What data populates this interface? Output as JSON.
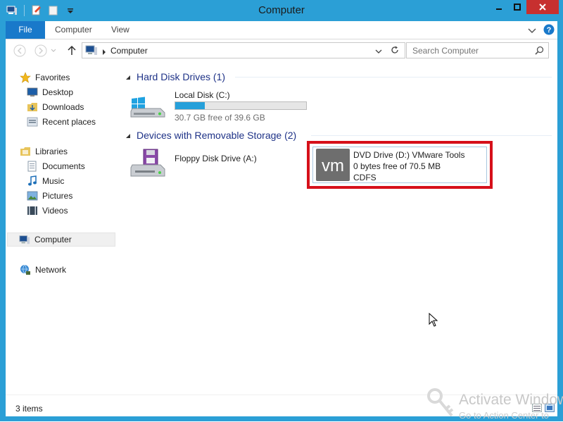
{
  "window": {
    "title": "Computer"
  },
  "ribbon": {
    "file": "File",
    "computer": "Computer",
    "view": "View"
  },
  "address": {
    "crumb": "Computer"
  },
  "search": {
    "placeholder": "Search Computer"
  },
  "nav": {
    "favorites": "Favorites",
    "desktop": "Desktop",
    "downloads": "Downloads",
    "recent": "Recent places",
    "libraries": "Libraries",
    "documents": "Documents",
    "music": "Music",
    "pictures": "Pictures",
    "videos": "Videos",
    "computer": "Computer",
    "network": "Network"
  },
  "groups": {
    "hdd": "Hard Disk Drives (1)",
    "removable": "Devices with Removable Storage (2)"
  },
  "drives": {
    "local": {
      "name": "Local Disk (C:)",
      "free": "30.7 GB free of 39.6 GB",
      "used_fraction": 0.225
    },
    "floppy": {
      "name": "Floppy Disk Drive (A:)"
    },
    "dvd": {
      "name": "DVD Drive (D:) VMware Tools",
      "free": "0 bytes free of 70.5 MB",
      "fs": "CDFS",
      "logo": "vm"
    }
  },
  "status": {
    "count": "3 items"
  },
  "watermark": {
    "line1": "Activate Windows",
    "line2": "Go to Action Center to"
  },
  "colors": {
    "accent": "#2b9fd6",
    "file_tab": "#1979ca",
    "highlight": "#d6101a",
    "close": "#c7302f",
    "bar_fill": "#26a0da"
  }
}
